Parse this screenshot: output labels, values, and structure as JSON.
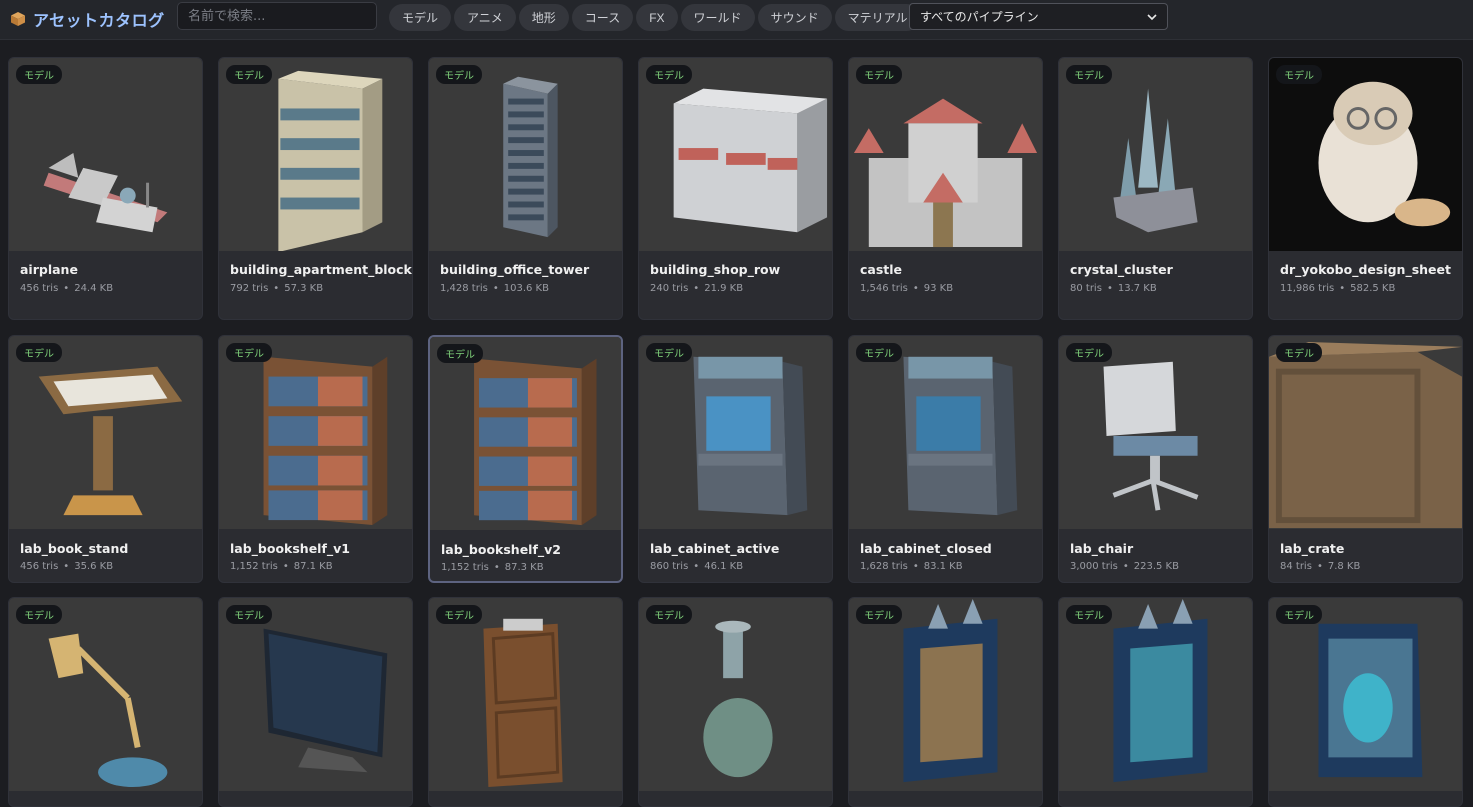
{
  "app": {
    "title": "アセットカタログ"
  },
  "search": {
    "placeholder": "名前で検索..."
  },
  "tabs": [
    "モデル",
    "アニメ",
    "地形",
    "コース",
    "FX",
    "ワールド",
    "サウンド",
    "マテリアル"
  ],
  "pipeline": {
    "selected": "すべてのパイプライン"
  },
  "colors": {
    "accent": "#9dc3ff",
    "badge_text": "#7fd17a"
  },
  "assets": [
    {
      "name": "airplane",
      "tris": "456 tris",
      "size": "24.4 KB",
      "badge": "モデル",
      "icon": "airplane"
    },
    {
      "name": "building_apartment_block",
      "tris": "792 tris",
      "size": "57.3 KB",
      "badge": "モデル",
      "icon": "apartment"
    },
    {
      "name": "building_office_tower",
      "tris": "1,428 tris",
      "size": "103.6 KB",
      "badge": "モデル",
      "icon": "tower"
    },
    {
      "name": "building_shop_row",
      "tris": "240 tris",
      "size": "21.9 KB",
      "badge": "モデル",
      "icon": "shop"
    },
    {
      "name": "castle",
      "tris": "1,546 tris",
      "size": "93 KB",
      "badge": "モデル",
      "icon": "castle"
    },
    {
      "name": "crystal_cluster",
      "tris": "80 tris",
      "size": "13.7 KB",
      "badge": "モデル",
      "icon": "crystal"
    },
    {
      "name": "dr_yokobo_design_sheet",
      "tris": "11,986 tris",
      "size": "582.5 KB",
      "badge": "モデル",
      "icon": "cat"
    },
    {
      "name": "lab_book_stand",
      "tris": "456 tris",
      "size": "35.6 KB",
      "badge": "モデル",
      "icon": "bookstand"
    },
    {
      "name": "lab_bookshelf_v1",
      "tris": "1,152 tris",
      "size": "87.1 KB",
      "badge": "モデル",
      "icon": "bookshelf"
    },
    {
      "name": "lab_bookshelf_v2",
      "tris": "1,152 tris",
      "size": "87.3 KB",
      "badge": "モデル",
      "icon": "bookshelf"
    },
    {
      "name": "lab_cabinet_active",
      "tris": "860 tris",
      "size": "46.1 KB",
      "badge": "モデル",
      "icon": "arcade"
    },
    {
      "name": "lab_cabinet_closed",
      "tris": "1,628 tris",
      "size": "83.1 KB",
      "badge": "モデル",
      "icon": "arcade2"
    },
    {
      "name": "lab_chair",
      "tris": "3,000 tris",
      "size": "223.5 KB",
      "badge": "モデル",
      "icon": "chair"
    },
    {
      "name": "lab_crate",
      "tris": "84 tris",
      "size": "7.8 KB",
      "badge": "モデル",
      "icon": "crate"
    },
    {
      "badge": "モデル",
      "icon": "lamp"
    },
    {
      "badge": "モデル",
      "icon": "monitor"
    },
    {
      "badge": "モデル",
      "icon": "door"
    },
    {
      "badge": "モデル",
      "icon": "flask"
    },
    {
      "badge": "モデル",
      "icon": "portal"
    },
    {
      "badge": "モデル",
      "icon": "portal2"
    },
    {
      "badge": "モデル",
      "icon": "capsule"
    }
  ]
}
